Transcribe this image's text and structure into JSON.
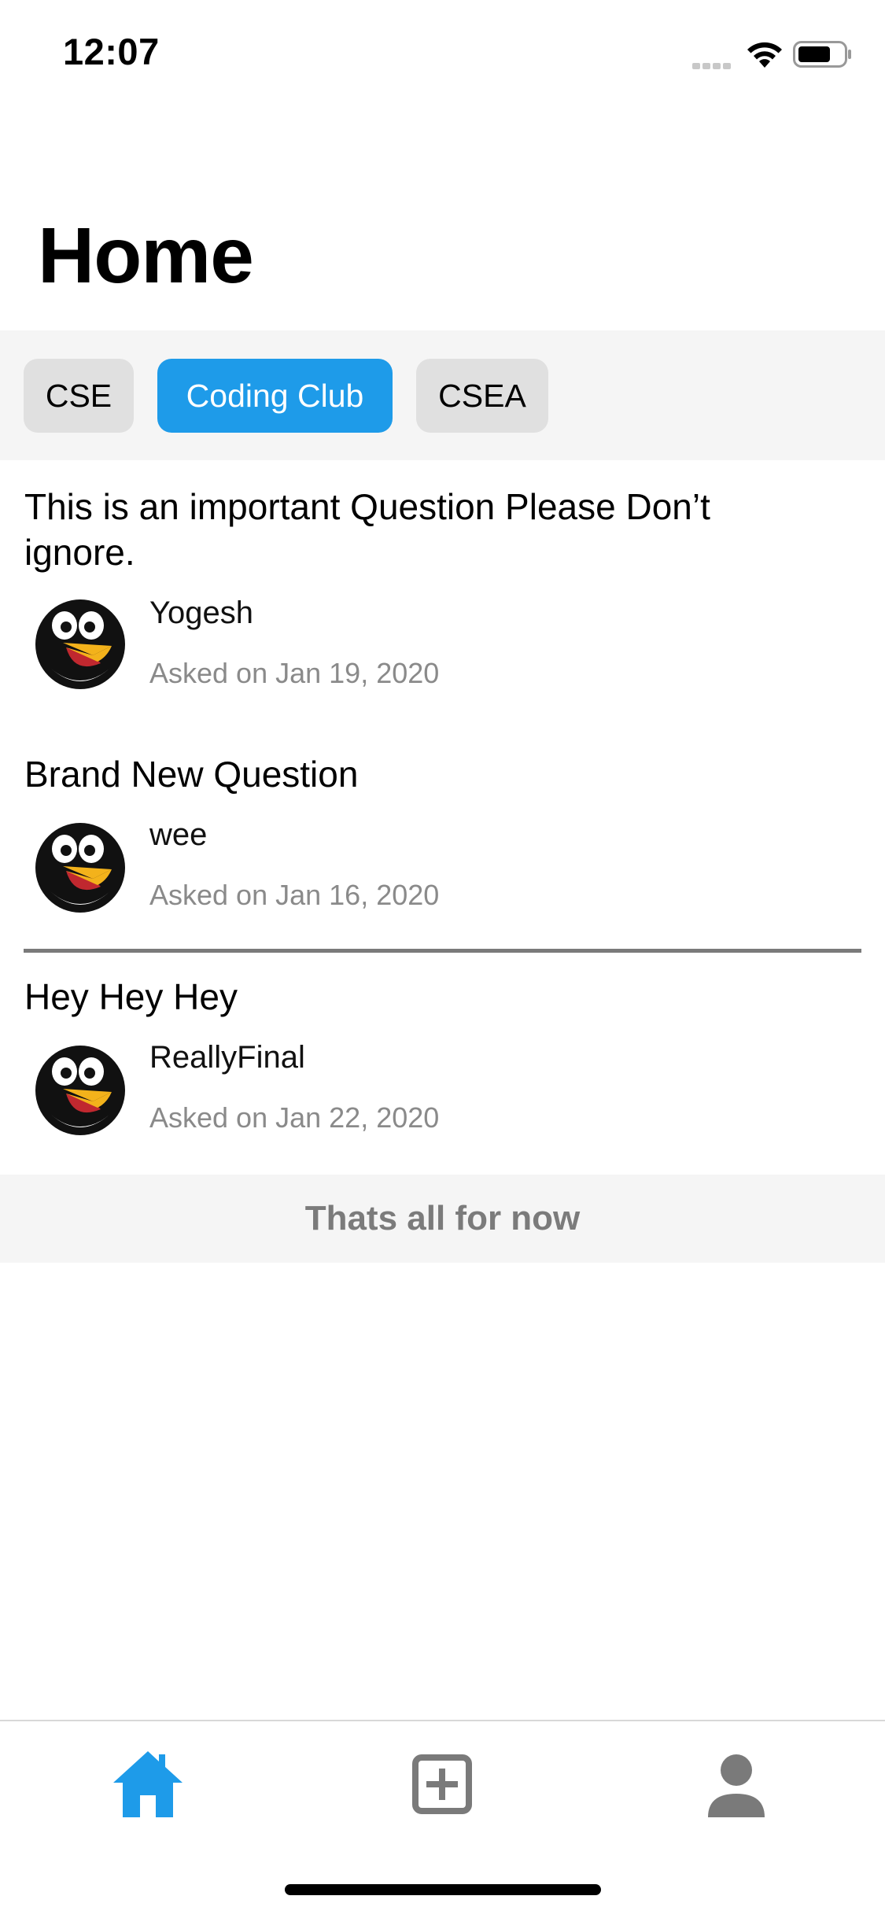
{
  "status_bar": {
    "time": "12:07"
  },
  "header": {
    "title": "Home"
  },
  "filters": [
    {
      "label": "CSE",
      "active": false
    },
    {
      "label": "Coding Club",
      "active": true
    },
    {
      "label": "CSEA",
      "active": false
    }
  ],
  "questions": [
    {
      "title": "This is an important Question Please Don’t ignore.",
      "author": "Yogesh",
      "asked": "Asked on Jan 19, 2020"
    },
    {
      "title": "Brand New Question",
      "author": "wee",
      "asked": "Asked on Jan 16, 2020"
    },
    {
      "title": "Hey Hey Hey",
      "author": "ReallyFinal",
      "asked": "Asked on Jan 22, 2020"
    }
  ],
  "footer_message": "Thats all for now",
  "tab_bar": {
    "items": [
      {
        "icon": "home-icon",
        "active": true
      },
      {
        "icon": "add-square-icon",
        "active": false
      },
      {
        "icon": "person-icon",
        "active": false
      }
    ]
  },
  "colors": {
    "accent": "#1e9be9",
    "chip_bg": "#e0e0e0",
    "muted_text": "#8a8a8a",
    "icon_gray": "#7a7a7a"
  }
}
